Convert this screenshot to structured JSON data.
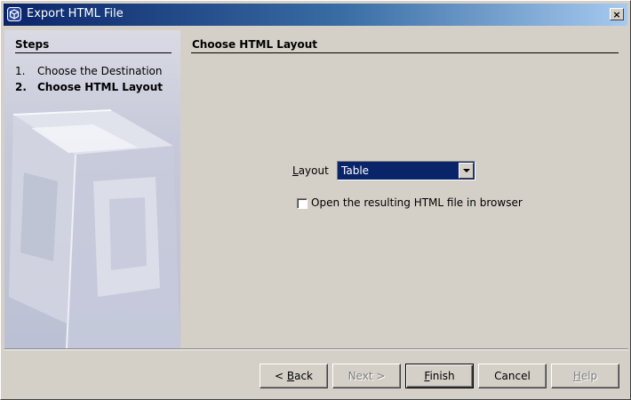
{
  "window": {
    "title": "Export HTML File",
    "app_icon": "netbeans-cube-icon",
    "close_glyph": "×"
  },
  "steps": {
    "title": "Steps",
    "items": [
      {
        "number": "1.",
        "label": "Choose the Destination",
        "current": false
      },
      {
        "number": "2.",
        "label": "Choose HTML Layout",
        "current": true
      }
    ]
  },
  "content": {
    "title": "Choose HTML Layout",
    "layout_label": "Layout",
    "layout_value": "Table",
    "open_in_browser_label": "Open the resulting HTML file in browser",
    "open_in_browser_checked": false
  },
  "buttons": {
    "back": "< Back",
    "next": "Next >",
    "finish": "Finish",
    "cancel": "Cancel",
    "help": "Help"
  },
  "colors": {
    "title_bar_start": "#0a246a",
    "title_bar_end": "#a6caf0",
    "dialog_face": "#d4d0c8",
    "selection": "#0a246a"
  }
}
